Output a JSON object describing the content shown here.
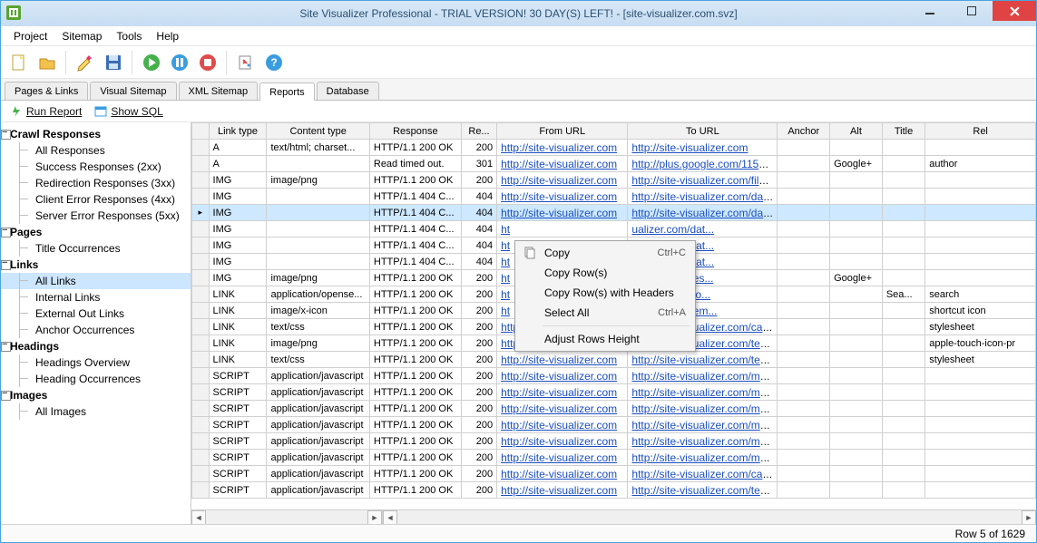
{
  "window": {
    "title": "Site Visualizer Professional - TRIAL VERSION! 30 DAY(S) LEFT! - [site-visualizer.com.svz]"
  },
  "menubar": [
    "Project",
    "Sitemap",
    "Tools",
    "Help"
  ],
  "tabs": [
    "Pages & Links",
    "Visual Sitemap",
    "XML Sitemap",
    "Reports",
    "Database"
  ],
  "subbar": {
    "run_report": "Run Report",
    "show_sql": "Show SQL"
  },
  "tree": [
    {
      "label": "Crawl Responses",
      "type": "parent"
    },
    {
      "label": "All Responses",
      "type": "child"
    },
    {
      "label": "Success Responses (2xx)",
      "type": "child"
    },
    {
      "label": "Redirection Responses (3xx)",
      "type": "child"
    },
    {
      "label": "Client Error Responses (4xx)",
      "type": "child"
    },
    {
      "label": "Server Error Responses (5xx)",
      "type": "child"
    },
    {
      "label": "Pages",
      "type": "parent"
    },
    {
      "label": "Title Occurrences",
      "type": "child"
    },
    {
      "label": "Links",
      "type": "parent"
    },
    {
      "label": "All Links",
      "type": "child",
      "selected": true
    },
    {
      "label": "Internal Links",
      "type": "child"
    },
    {
      "label": "External Out Links",
      "type": "child"
    },
    {
      "label": "Anchor Occurrences",
      "type": "child"
    },
    {
      "label": "Headings",
      "type": "parent"
    },
    {
      "label": "Headings Overview",
      "type": "child"
    },
    {
      "label": "Heading Occurrences",
      "type": "child"
    },
    {
      "label": "Images",
      "type": "parent"
    },
    {
      "label": "All Images",
      "type": "child"
    }
  ],
  "grid": {
    "columns": [
      "Link type",
      "Content type",
      "Response",
      "Re...",
      "From URL",
      "To URL",
      "Anchor",
      "Alt",
      "Title",
      "Rel"
    ],
    "rows": [
      {
        "link_type": "A",
        "content_type": "text/html; charset...",
        "response": "HTTP/1.1 200 OK",
        "code": "200",
        "from": "http://site-visualizer.com",
        "to": "http://site-visualizer.com",
        "anchor": "",
        "alt": "",
        "title": "",
        "rel": ""
      },
      {
        "link_type": "A",
        "content_type": "",
        "response": "Read timed out.",
        "code": "301",
        "from": "http://site-visualizer.com",
        "to": "http://plus.google.com/1154...",
        "anchor": "",
        "alt": "Google+",
        "title": "",
        "rel": "author"
      },
      {
        "link_type": "IMG",
        "content_type": "image/png",
        "response": "HTTP/1.1 200 OK",
        "code": "200",
        "from": "http://site-visualizer.com",
        "to": "http://site-visualizer.com/file...",
        "anchor": "",
        "alt": "",
        "title": "",
        "rel": ""
      },
      {
        "link_type": "IMG",
        "content_type": "",
        "response": "HTTP/1.1 404 C...",
        "code": "404",
        "from": "http://site-visualizer.com",
        "to": "http://site-visualizer.com/dat...",
        "anchor": "",
        "alt": "",
        "title": "",
        "rel": ""
      },
      {
        "link_type": "IMG",
        "content_type": "",
        "response": "HTTP/1.1 404 C...",
        "code": "404",
        "from": "http://site-visualizer.com",
        "to": "http://site-visualizer.com/dat...",
        "anchor": "",
        "alt": "",
        "title": "",
        "rel": "",
        "selected": true
      },
      {
        "link_type": "IMG",
        "content_type": "",
        "response": "HTTP/1.1 404 C...",
        "code": "404",
        "from": "ht",
        "to": "ualizer.com/dat...",
        "anchor": "",
        "alt": "",
        "title": "",
        "rel": ""
      },
      {
        "link_type": "IMG",
        "content_type": "",
        "response": "HTTP/1.1 404 C...",
        "code": "404",
        "from": "ht",
        "to": "ualizer.com/dat...",
        "anchor": "",
        "alt": "",
        "title": "",
        "rel": ""
      },
      {
        "link_type": "IMG",
        "content_type": "",
        "response": "HTTP/1.1 404 C...",
        "code": "404",
        "from": "ht",
        "to": "ualizer.com/dat...",
        "anchor": "",
        "alt": "",
        "title": "",
        "rel": ""
      },
      {
        "link_type": "IMG",
        "content_type": "image/png",
        "response": "HTTP/1.1 200 OK",
        "code": "200",
        "from": "ht",
        "to": "tic.com/images...",
        "anchor": "",
        "alt": "Google+",
        "title": "",
        "rel": ""
      },
      {
        "link_type": "LINK",
        "content_type": "application/opense...",
        "response": "HTTP/1.1 200 OK",
        "code": "200",
        "from": "ht",
        "to": "ualizer.com/co...",
        "anchor": "",
        "alt": "",
        "title": "Sea...",
        "rel": "search"
      },
      {
        "link_type": "LINK",
        "content_type": "image/x-icon",
        "response": "HTTP/1.1 200 OK",
        "code": "200",
        "from": "ht",
        "to": "ualizer.com/tem...",
        "anchor": "",
        "alt": "",
        "title": "",
        "rel": "shortcut icon"
      },
      {
        "link_type": "LINK",
        "content_type": "text/css",
        "response": "HTTP/1.1 200 OK",
        "code": "200",
        "from": "http://site-visualizer.com",
        "to": "http://site-visualizer.com/cac...",
        "anchor": "",
        "alt": "",
        "title": "",
        "rel": "stylesheet"
      },
      {
        "link_type": "LINK",
        "content_type": "image/png",
        "response": "HTTP/1.1 200 OK",
        "code": "200",
        "from": "http://site-visualizer.com",
        "to": "http://site-visualizer.com/tem...",
        "anchor": "",
        "alt": "",
        "title": "",
        "rel": "apple-touch-icon-pr"
      },
      {
        "link_type": "LINK",
        "content_type": "text/css",
        "response": "HTTP/1.1 200 OK",
        "code": "200",
        "from": "http://site-visualizer.com",
        "to": "http://site-visualizer.com/tem...",
        "anchor": "",
        "alt": "",
        "title": "",
        "rel": "stylesheet"
      },
      {
        "link_type": "SCRIPT",
        "content_type": "application/javascript",
        "response": "HTTP/1.1 200 OK",
        "code": "200",
        "from": "http://site-visualizer.com",
        "to": "http://site-visualizer.com/me...",
        "anchor": "",
        "alt": "",
        "title": "",
        "rel": ""
      },
      {
        "link_type": "SCRIPT",
        "content_type": "application/javascript",
        "response": "HTTP/1.1 200 OK",
        "code": "200",
        "from": "http://site-visualizer.com",
        "to": "http://site-visualizer.com/me...",
        "anchor": "",
        "alt": "",
        "title": "",
        "rel": ""
      },
      {
        "link_type": "SCRIPT",
        "content_type": "application/javascript",
        "response": "HTTP/1.1 200 OK",
        "code": "200",
        "from": "http://site-visualizer.com",
        "to": "http://site-visualizer.com/me...",
        "anchor": "",
        "alt": "",
        "title": "",
        "rel": ""
      },
      {
        "link_type": "SCRIPT",
        "content_type": "application/javascript",
        "response": "HTTP/1.1 200 OK",
        "code": "200",
        "from": "http://site-visualizer.com",
        "to": "http://site-visualizer.com/me...",
        "anchor": "",
        "alt": "",
        "title": "",
        "rel": ""
      },
      {
        "link_type": "SCRIPT",
        "content_type": "application/javascript",
        "response": "HTTP/1.1 200 OK",
        "code": "200",
        "from": "http://site-visualizer.com",
        "to": "http://site-visualizer.com/me...",
        "anchor": "",
        "alt": "",
        "title": "",
        "rel": ""
      },
      {
        "link_type": "SCRIPT",
        "content_type": "application/javascript",
        "response": "HTTP/1.1 200 OK",
        "code": "200",
        "from": "http://site-visualizer.com",
        "to": "http://site-visualizer.com/me...",
        "anchor": "",
        "alt": "",
        "title": "",
        "rel": ""
      },
      {
        "link_type": "SCRIPT",
        "content_type": "application/javascript",
        "response": "HTTP/1.1 200 OK",
        "code": "200",
        "from": "http://site-visualizer.com",
        "to": "http://site-visualizer.com/cac...",
        "anchor": "",
        "alt": "",
        "title": "",
        "rel": ""
      },
      {
        "link_type": "SCRIPT",
        "content_type": "application/javascript",
        "response": "HTTP/1.1 200 OK",
        "code": "200",
        "from": "http://site-visualizer.com",
        "to": "http://site-visualizer.com/tem...",
        "anchor": "",
        "alt": "",
        "title": "",
        "rel": ""
      }
    ]
  },
  "context_menu": [
    {
      "label": "Copy",
      "shortcut": "Ctrl+C"
    },
    {
      "label": "Copy Row(s)"
    },
    {
      "label": "Copy Row(s) with Headers"
    },
    {
      "label": "Select All",
      "shortcut": "Ctrl+A"
    },
    {
      "label": "Adjust Rows Height"
    }
  ],
  "status": "Row 5 of 1629"
}
